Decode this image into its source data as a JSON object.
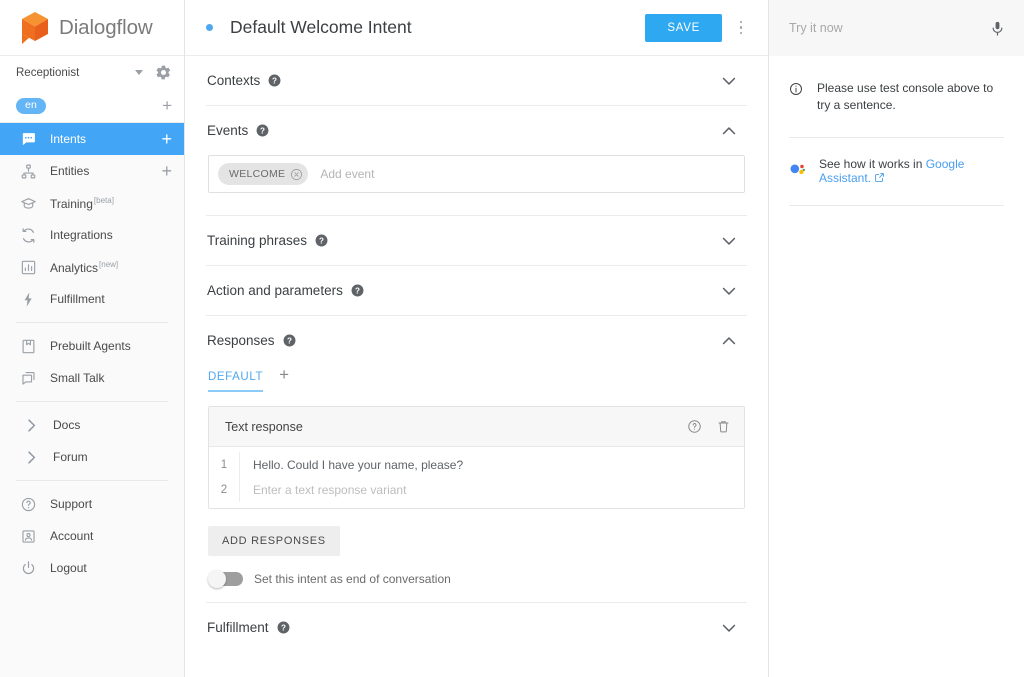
{
  "brand": {
    "name": "Dialogflow",
    "logo_icon": "dialogflow-cube-icon",
    "accent_blue": "#42a5f5",
    "logo_orange": "#f07c1f"
  },
  "sidebar": {
    "agent": {
      "name": "Receptionist",
      "dropdown_icon": "chevron-down-icon",
      "settings_icon": "gear-icon"
    },
    "language": {
      "chip": "en",
      "add_icon": "plus-icon"
    },
    "items": [
      {
        "label": "Intents",
        "icon": "chat-bubble-icon",
        "active": true,
        "trailing": "+"
      },
      {
        "label": "Entities",
        "icon": "entities-node-icon",
        "active": false,
        "trailing": "+"
      },
      {
        "label": "Training",
        "icon": "graduation-cap-icon",
        "active": false,
        "sup": "[beta]"
      },
      {
        "label": "Integrations",
        "icon": "sync-arrows-icon",
        "active": false
      },
      {
        "label": "Analytics",
        "icon": "bar-chart-icon",
        "active": false,
        "sup": "[new]"
      },
      {
        "label": "Fulfillment",
        "icon": "lightning-bolt-icon",
        "active": false
      }
    ],
    "items2": [
      {
        "label": "Prebuilt Agents",
        "icon": "book-save-icon"
      },
      {
        "label": "Small Talk",
        "icon": "copy-bubbles-icon"
      }
    ],
    "items3": [
      {
        "label": "Docs",
        "icon": "chevron-right-icon"
      },
      {
        "label": "Forum",
        "icon": "chevron-right-icon"
      }
    ],
    "items4": [
      {
        "label": "Support",
        "icon": "help-circle-icon"
      },
      {
        "label": "Account",
        "icon": "account-box-icon"
      },
      {
        "label": "Logout",
        "icon": "power-icon"
      }
    ]
  },
  "header": {
    "status_dot_color": "#4fa8ef",
    "title": "Default Welcome Intent",
    "save_label": "SAVE",
    "menu_icon": "kebab-menu-icon"
  },
  "sections": {
    "contexts": {
      "title": "Contexts",
      "help_icon": "help-icon",
      "chevron": "chevron-down-icon",
      "expanded": false
    },
    "events": {
      "title": "Events",
      "help_icon": "help-icon",
      "chevron": "chevron-up-icon",
      "expanded": true,
      "chips": [
        {
          "label": "WELCOME",
          "remove_icon": "close-circle-icon"
        }
      ],
      "placeholder": "Add event"
    },
    "training_phrases": {
      "title": "Training phrases",
      "help_icon": "help-icon",
      "chevron": "chevron-down-icon",
      "expanded": false
    },
    "action_parameters": {
      "title": "Action and parameters",
      "help_icon": "help-icon",
      "chevron": "chevron-down-icon",
      "expanded": false
    },
    "responses": {
      "title": "Responses",
      "help_icon": "help-icon",
      "chevron": "chevron-up-icon",
      "expanded": true,
      "tab_label": "DEFAULT",
      "tab_add_icon": "plus-icon",
      "card": {
        "title": "Text response",
        "help_icon": "help-circle-icon",
        "delete_icon": "trash-icon",
        "rows": [
          {
            "num": "1",
            "value": "Hello. Could I have your name, please?",
            "is_placeholder": false
          },
          {
            "num": "2",
            "value": "Enter a text response variant",
            "is_placeholder": true
          }
        ]
      },
      "add_responses_label": "ADD RESPONSES",
      "end_of_conversation": {
        "label": "Set this intent as end of conversation",
        "enabled": false
      }
    },
    "fulfillment": {
      "title": "Fulfillment",
      "help_icon": "help-icon",
      "chevron": "chevron-down-icon",
      "expanded": false
    }
  },
  "right_panel": {
    "try_placeholder": "Try it now",
    "mic_icon": "microphone-icon",
    "notice": {
      "icon": "info-icon",
      "text": "Please use test console above to try a sentence."
    },
    "assistant": {
      "icon": "google-assistant-icon",
      "text_before": "See how it works in ",
      "link_text": "Google Assistant.",
      "external_icon": "external-link-icon"
    }
  }
}
